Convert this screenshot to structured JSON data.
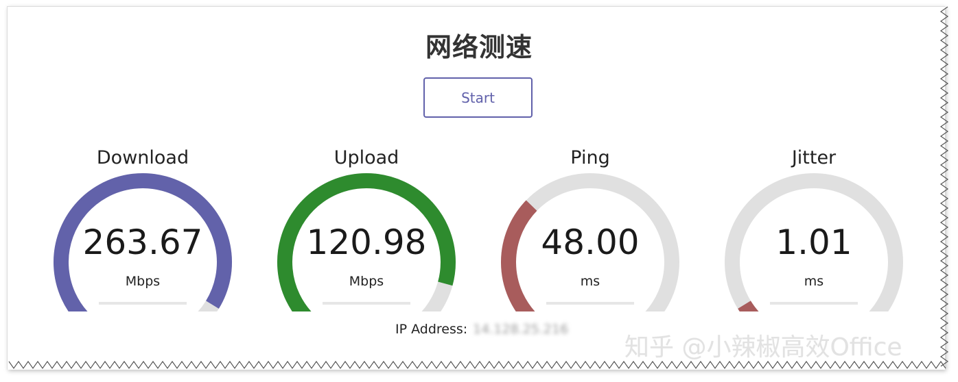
{
  "header": {
    "title": "网络测速",
    "start_label": "Start"
  },
  "meters": [
    {
      "label": "Download",
      "value": "263.67",
      "unit": "Mbps",
      "fill_fraction": 0.95,
      "color": "#6262aa"
    },
    {
      "label": "Upload",
      "value": "120.98",
      "unit": "Mbps",
      "fill_fraction": 0.89,
      "color": "#2e8b2e"
    },
    {
      "label": "Ping",
      "value": "48.00",
      "unit": "ms",
      "fill_fraction": 0.33,
      "color": "#a85c5c"
    },
    {
      "label": "Jitter",
      "value": "1.01",
      "unit": "ms",
      "fill_fraction": 0.05,
      "color": "#a85c5c"
    }
  ],
  "ip": {
    "label": "IP Address:",
    "value": "14.128.25.216"
  },
  "watermark": "知乎 @小辣椒高效Office",
  "colors": {
    "track": "#e0e0e0",
    "accent": "#6060aa"
  }
}
